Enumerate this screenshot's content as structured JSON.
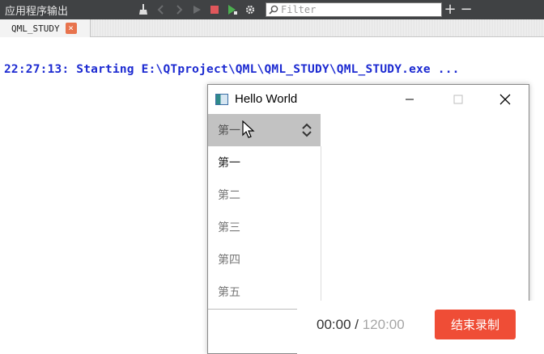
{
  "ide": {
    "pane_title": "应用程序输出",
    "filter_placeholder": "Filter",
    "tab_label": "QML_STUDY",
    "tab_close": "×",
    "output_line": "22:27:13: Starting E:\\QTproject\\QML\\QML_STUDY\\QML_STUDY.exe ..."
  },
  "window": {
    "title": "Hello World",
    "combo_value": "第一",
    "items": [
      "第一",
      "第二",
      "第三",
      "第四",
      "第五"
    ]
  },
  "recorder": {
    "elapsed": "00:00",
    "separator": " / ",
    "total": "120:00",
    "stop_label": "结束录制"
  },
  "colors": {
    "output_text": "#1c2ad1",
    "stop_button": "#ef4d36",
    "run_icon": "#4caf50",
    "stop_icon": "#e0575b"
  }
}
